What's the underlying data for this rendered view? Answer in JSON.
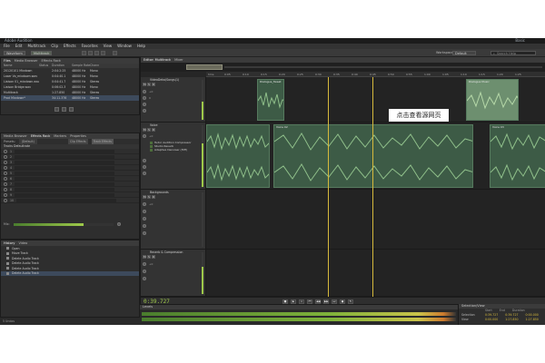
{
  "app": {
    "title": "Adobe Audition",
    "version": "Basic"
  },
  "menu": [
    "File",
    "Edit",
    "Multitrack",
    "Clip",
    "Effects",
    "Favorites",
    "View",
    "Window",
    "Help"
  ],
  "toolbar": {
    "waveform_label": "Waveform",
    "multitrack_label": "Multitrack",
    "workspace_label": "Workspace:",
    "workspace_value": "Default",
    "search_placeholder": "Search Help"
  },
  "files_panel": {
    "tabs": [
      "Files",
      "Media Browser",
      "Effects Rack"
    ],
    "columns": [
      "Name",
      "Status",
      "Duration",
      "Sample Rate",
      "Channels"
    ],
    "rows": [
      {
        "name": "20120101 Mixdown",
        "status": "",
        "duration": "2:04:2:25",
        "rate": "48000 Hz",
        "ch": "Mono"
      },
      {
        "name": "Laser Vo_mixdown.wav",
        "status": "",
        "duration": "0:04:40.1",
        "rate": "48000 Hz",
        "ch": "Mono"
      },
      {
        "name": "Liaison 01_mixdown.wav",
        "status": "",
        "duration": "0:04:41.7",
        "rate": "48000 Hz",
        "ch": "Stereo"
      },
      {
        "name": "Liaison Bridge.wav",
        "status": "",
        "duration": "0:06:02.3",
        "rate": "48000 Hz",
        "ch": "Mono"
      },
      {
        "name": "Multitrack",
        "status": "",
        "duration": "1:27.850",
        "rate": "48000 Hz",
        "ch": "Stereo"
      },
      {
        "name": "Prod Mixdown*",
        "status": "",
        "duration": "34:11.376",
        "rate": "48000 Hz",
        "ch": "Stereo"
      }
    ]
  },
  "effects_panel": {
    "tabs": [
      "Media Browser",
      "Effects Rack",
      "Markers",
      "Properties"
    ],
    "presets_label": "Presets:",
    "presets_value": "(Default)",
    "clip_effects": "Clip Effects",
    "track_effects": "Track Effects",
    "section": "Tracks Defaultrate",
    "slots": [
      "1",
      "2",
      "3",
      "4",
      "5",
      "6",
      "7",
      "8",
      "9",
      "10"
    ],
    "mix_label": "Mix:"
  },
  "history_panel": {
    "tabs": [
      "History",
      "Video"
    ],
    "items": [
      "Open",
      "Move Track",
      "Delete Audio Track",
      "Delete Audio Track",
      "Delete Audio Track",
      "Delete Audio Track"
    ],
    "status": "5 Undos"
  },
  "editor": {
    "tabs": [
      "Editor: Multitrack",
      "Mixer"
    ],
    "ruler": [
      "hms",
      "0:05",
      "0:10",
      "0:15",
      "0:20",
      "0:25",
      "0:30",
      "0:35",
      "0:40",
      "0:45",
      "0:50",
      "0:55",
      "1:00",
      "1:05",
      "1:10",
      "1:15",
      "1:20",
      "1:25"
    ],
    "tracks": [
      {
        "name": "VideoDeko/Songs(1)",
        "clips": [
          "Dialogue_Tweet",
          "Dialogue Music"
        ]
      },
      {
        "name": "Voice",
        "sends": [
          "Tudor Audition Compressor",
          "Studio Reverb",
          "Adaptive Denoiser (HiFi)"
        ],
        "clips": [
          "Voice 02",
          "Voice 03"
        ]
      },
      {
        "name": "Backgrounds",
        "clips": []
      },
      {
        "name": "Reverb & Compression",
        "clips": []
      }
    ],
    "timecode": "0:39.727",
    "transport": [
      "■",
      "▶",
      "⏸",
      "⏮",
      "◀◀",
      "▶▶",
      "⏭",
      "●",
      "↻"
    ]
  },
  "levels": {
    "title": "Levels"
  },
  "selection_view": {
    "tabs": [
      "Selection/View"
    ],
    "headers": [
      "Start",
      "End",
      "Duration"
    ],
    "rows": [
      {
        "label": "Selection",
        "start": "0:39.727",
        "end": "0:39.727",
        "dur": "0:00.000"
      },
      {
        "label": "View",
        "start": "0:00.000",
        "end": "1:27.850",
        "dur": "1:27.850"
      }
    ]
  },
  "watermark": "点击查看源网页",
  "colors": {
    "bg": "#2b2b2b",
    "clip": "#3d5b46",
    "wave": "#8fbf8a",
    "cti": "#d6b93c",
    "timecode": "#9ec94a"
  }
}
